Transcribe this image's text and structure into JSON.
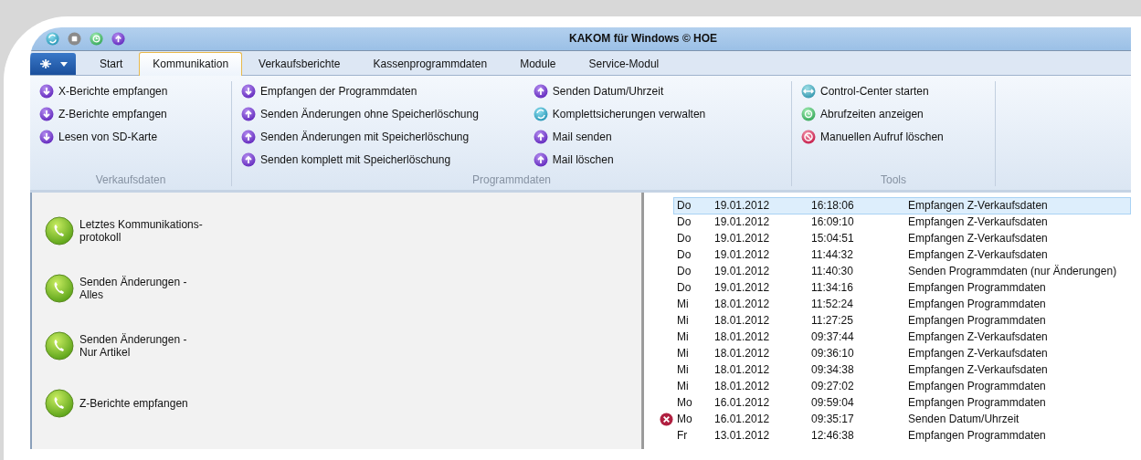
{
  "window": {
    "title": "KAKOM für Windows © HOE"
  },
  "tabs": [
    {
      "label": "Start",
      "selected": false
    },
    {
      "label": "Kommunikation",
      "selected": true
    },
    {
      "label": "Verkaufsberichte",
      "selected": false
    },
    {
      "label": "Kassenprogrammdaten",
      "selected": false
    },
    {
      "label": "Module",
      "selected": false
    },
    {
      "label": "Service-Modul",
      "selected": false
    }
  ],
  "ribbon_groups": [
    {
      "label": "Verkaufsdaten",
      "columns": [
        [
          {
            "label": "X-Berichte empfangen",
            "kind": "download"
          },
          {
            "label": "Z-Berichte empfangen",
            "kind": "download"
          },
          {
            "label": "Lesen von SD-Karte",
            "kind": "download"
          }
        ]
      ]
    },
    {
      "label": "Programmdaten",
      "columns": [
        [
          {
            "label": "Empfangen der Programmdaten",
            "kind": "download"
          },
          {
            "label": "Senden Änderungen ohne Speicherlöschung",
            "kind": "upload"
          },
          {
            "label": "Senden Änderungen mit Speicherlöschung",
            "kind": "upload"
          },
          {
            "label": "Senden komplett mit Speicherlöschung",
            "kind": "upload"
          }
        ],
        [
          {
            "label": "Senden Datum/Uhrzeit",
            "kind": "upload"
          },
          {
            "label": "Komplettsicherungen verwalten",
            "kind": "sync"
          },
          {
            "label": "Mail senden",
            "kind": "upload"
          },
          {
            "label": "Mail löschen",
            "kind": "upload"
          }
        ]
      ]
    },
    {
      "label": "Tools",
      "columns": [
        [
          {
            "label": "Control-Center starten",
            "kind": "arrows"
          },
          {
            "label": "Abrufzeiten anzeigen",
            "kind": "clock"
          },
          {
            "label": "Manuellen Aufruf löschen",
            "kind": "stop"
          }
        ]
      ]
    }
  ],
  "actions": [
    {
      "label": "Letztes Kommunikations-\nprotokoll"
    },
    {
      "label": "Senden Änderungen -\nAlles"
    },
    {
      "label": "Senden Änderungen -\nNur Artikel"
    },
    {
      "label": "Z-Berichte empfangen"
    }
  ],
  "log": [
    {
      "day": "Do",
      "date": "19.01.2012",
      "time": "16:18:06",
      "event": "Empfangen Z-Verkaufsdaten",
      "selected": true,
      "error": false
    },
    {
      "day": "Do",
      "date": "19.01.2012",
      "time": "16:09:10",
      "event": "Empfangen Z-Verkaufsdaten",
      "selected": false,
      "error": false
    },
    {
      "day": "Do",
      "date": "19.01.2012",
      "time": "15:04:51",
      "event": "Empfangen Z-Verkaufsdaten",
      "selected": false,
      "error": false
    },
    {
      "day": "Do",
      "date": "19.01.2012",
      "time": "11:44:32",
      "event": "Empfangen Z-Verkaufsdaten",
      "selected": false,
      "error": false
    },
    {
      "day": "Do",
      "date": "19.01.2012",
      "time": "11:40:30",
      "event": "Senden Programmdaten (nur Änderungen)",
      "selected": false,
      "error": false
    },
    {
      "day": "Do",
      "date": "19.01.2012",
      "time": "11:34:16",
      "event": "Empfangen Programmdaten",
      "selected": false,
      "error": false
    },
    {
      "day": "Mi",
      "date": "18.01.2012",
      "time": "11:52:24",
      "event": "Empfangen Programmdaten",
      "selected": false,
      "error": false
    },
    {
      "day": "Mi",
      "date": "18.01.2012",
      "time": "11:27:25",
      "event": "Empfangen Programmdaten",
      "selected": false,
      "error": false
    },
    {
      "day": "Mi",
      "date": "18.01.2012",
      "time": "09:37:44",
      "event": "Empfangen Z-Verkaufsdaten",
      "selected": false,
      "error": false
    },
    {
      "day": "Mi",
      "date": "18.01.2012",
      "time": "09:36:10",
      "event": "Empfangen Z-Verkaufsdaten",
      "selected": false,
      "error": false
    },
    {
      "day": "Mi",
      "date": "18.01.2012",
      "time": "09:34:38",
      "event": "Empfangen Z-Verkaufsdaten",
      "selected": false,
      "error": false
    },
    {
      "day": "Mi",
      "date": "18.01.2012",
      "time": "09:27:02",
      "event": "Empfangen Programmdaten",
      "selected": false,
      "error": false
    },
    {
      "day": "Mo",
      "date": "16.01.2012",
      "time": "09:59:04",
      "event": "Empfangen Programmdaten",
      "selected": false,
      "error": false
    },
    {
      "day": "Mo",
      "date": "16.01.2012",
      "time": "09:35:17",
      "event": "Senden Datum/Uhrzeit",
      "selected": false,
      "error": true
    },
    {
      "day": "Fr",
      "date": "13.01.2012",
      "time": "12:46:38",
      "event": "Empfangen Programmdaten",
      "selected": false,
      "error": false
    }
  ]
}
